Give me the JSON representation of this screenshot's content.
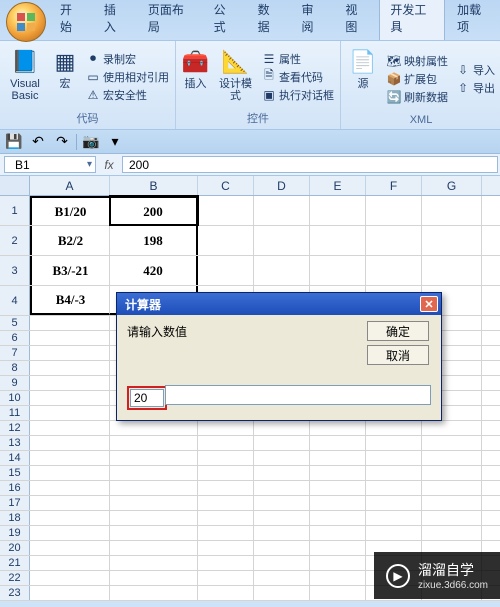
{
  "tabs": {
    "home": "开始",
    "insert": "插入",
    "pagelayout": "页面布局",
    "formulas": "公式",
    "data": "数据",
    "review": "审阅",
    "view": "视图",
    "developer": "开发工具",
    "addins": "加载项"
  },
  "ribbon": {
    "code": {
      "vb": "Visual Basic",
      "macros": "宏",
      "record": "录制宏",
      "relative": "使用相对引用",
      "security": "宏安全性",
      "group": "代码"
    },
    "controls": {
      "insert": "插入",
      "design": "设计模式",
      "properties": "属性",
      "viewcode": "查看代码",
      "rundialog": "执行对话框",
      "group": "控件"
    },
    "xml": {
      "source": "源",
      "mapprops": "映射属性",
      "expansion": "扩展包",
      "refresh": "刷新数据",
      "import": "导入",
      "export": "导出",
      "group": "XML"
    }
  },
  "namebox": "B1",
  "fx": "fx",
  "formula_value": "200",
  "columns": [
    "A",
    "B",
    "C",
    "D",
    "E",
    "F",
    "G"
  ],
  "rows": [
    1,
    2,
    3,
    4,
    5,
    6,
    7,
    8,
    9,
    10,
    11,
    12,
    13,
    14,
    15,
    16,
    17,
    18,
    19,
    20,
    21,
    22,
    23
  ],
  "cells": {
    "A1": "B1/20",
    "B1": "200",
    "A2": "B2/2",
    "B2": "198",
    "A3": "B3/-21",
    "B3": "420",
    "A4": "B4/-3",
    "B4": ""
  },
  "dialog": {
    "title": "计算器",
    "prompt": "请输入数值",
    "ok": "确定",
    "cancel": "取消",
    "input": "20"
  },
  "watermark": {
    "brand": "溜溜自学",
    "url": "zixue.3d66.com"
  }
}
